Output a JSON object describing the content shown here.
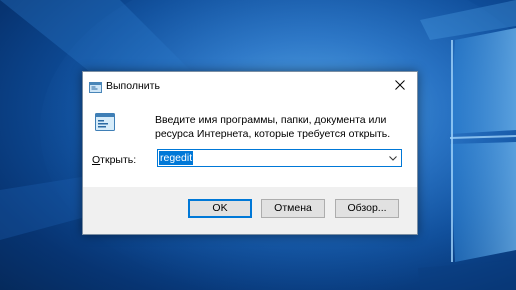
{
  "window": {
    "title": "Выполнить",
    "icon": "run-dialog-icon"
  },
  "body": {
    "icon": "run-program-icon",
    "description": "Введите имя программы, папки, документа или ресурса Интернета, которые требуется открыть.",
    "open_label": "Открыть:",
    "open_label_accel": "О",
    "open_label_rest": "ткрыть:",
    "combo": {
      "value": "regedit",
      "selected": true
    }
  },
  "buttons": {
    "ok": "OK",
    "cancel": "Отмена",
    "browse": "Обзор..."
  },
  "colors": {
    "accent": "#0078d7",
    "desktop": "#1f69bd",
    "footer": "#f0f0f0"
  }
}
